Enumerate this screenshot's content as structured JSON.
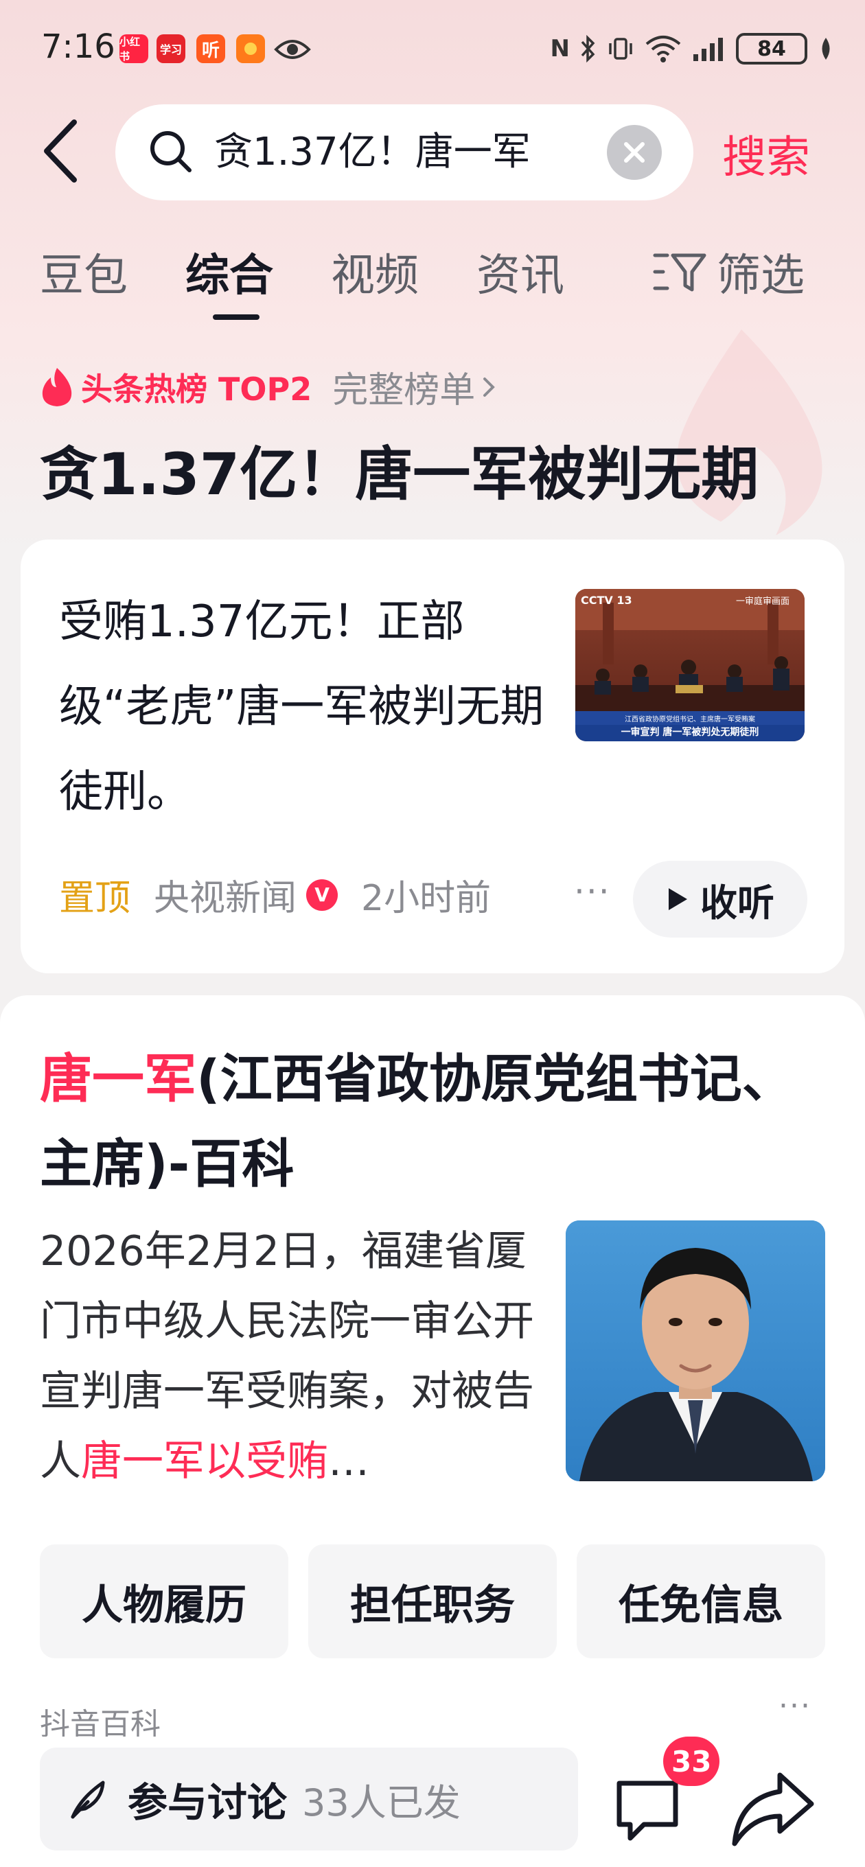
{
  "status_bar": {
    "time": "7:16",
    "apps": [
      {
        "name": "xiaohongshu-icon",
        "label": "小红书",
        "color": "#ff2442"
      },
      {
        "name": "xuexi-icon",
        "label": "学习",
        "color": "#e6242b"
      },
      {
        "name": "ting-icon",
        "label": "听",
        "color": "#ff5a1e"
      },
      {
        "name": "app-icon",
        "label": "",
        "color": "#ff7a1a"
      },
      {
        "name": "eye-icon",
        "label": ""
      }
    ],
    "battery": "84"
  },
  "search": {
    "query": "贪1.37亿！唐一军",
    "button": "搜索"
  },
  "tabs": [
    {
      "label": "豆包",
      "active": false
    },
    {
      "label": "综合",
      "active": true
    },
    {
      "label": "视频",
      "active": false
    },
    {
      "label": "资讯",
      "active": false
    }
  ],
  "filter_label": "筛选",
  "hot": {
    "label": "头条热榜 TOP2",
    "link": "完整榜单",
    "title": "贪1.37亿！唐一军被判无期"
  },
  "news_card": {
    "text": "受贿1.37亿元！正部级“老虎”唐一军被判无期徒刑。",
    "pinned": "置顶",
    "source": "央视新闻",
    "verified": "V",
    "time": "2小时前",
    "listen": "收听",
    "thumb": {
      "channel": "CCTV 13",
      "top_caption": "一审庭审画面",
      "caption_1": "江西省政协原党组书记、主席唐一军受贿案",
      "caption_2": "一审宣判 唐一军被判处无期徒刑"
    }
  },
  "baike": {
    "title_highlight": "唐一军",
    "title_rest": "(江西省政协原党组书记、主席)-百科",
    "body_plain": "2026年2月2日，福建省厦门市中级人民法院一审公开宣判唐一军受贿案，对被告人",
    "body_highlight": "唐一军以受贿",
    "body_ellipsis": "…",
    "chips": [
      "人物履历",
      "担任职务",
      "任免信息"
    ],
    "source": "抖音百科"
  },
  "bottom_bar": {
    "discuss_label": "参与讨论",
    "discuss_count": "33人已发",
    "comment_badge": "33"
  },
  "colors": {
    "accent": "#fe2c55",
    "pinned": "#e3a116",
    "text_primary": "#161823",
    "text_secondary": "#8a8b91"
  }
}
